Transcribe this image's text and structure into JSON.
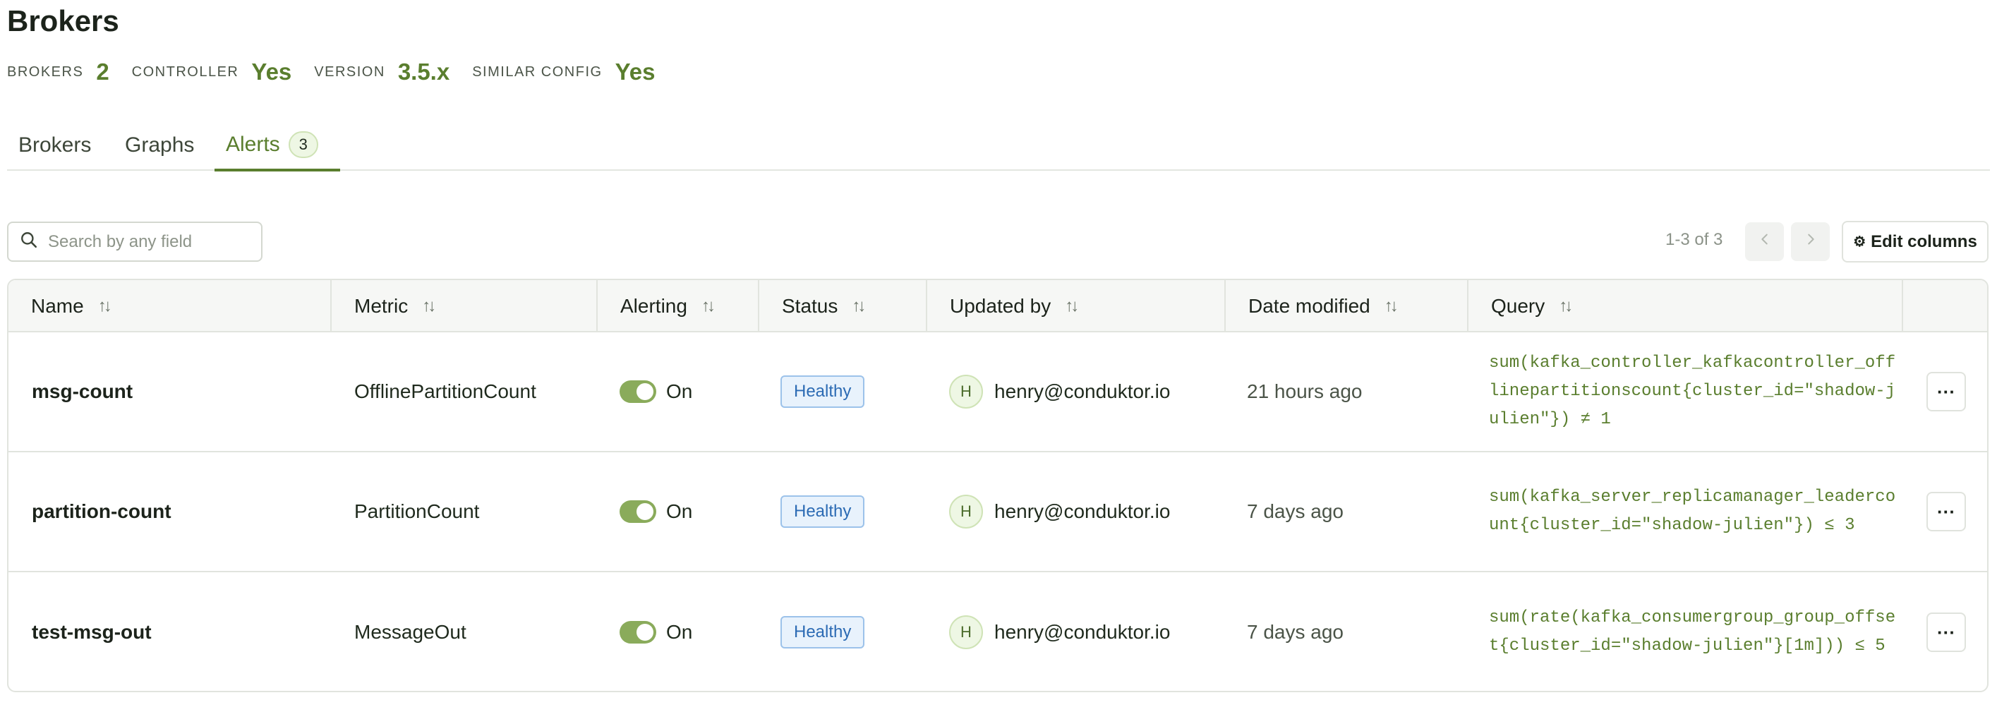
{
  "page": {
    "title": "Brokers"
  },
  "stats": [
    {
      "label": "BROKERS",
      "value": "2"
    },
    {
      "label": "CONTROLLER",
      "value": "Yes"
    },
    {
      "label": "VERSION",
      "value": "3.5.x"
    },
    {
      "label": "SIMILAR CONFIG",
      "value": "Yes"
    }
  ],
  "tabs": {
    "brokers": "Brokers",
    "graphs": "Graphs",
    "alerts": "Alerts",
    "alerts_count": "3",
    "active": "alerts"
  },
  "search": {
    "placeholder": "Search by any field",
    "value": ""
  },
  "pagination": {
    "text": "1-3 of 3"
  },
  "toolbar": {
    "edit_columns_label": "Edit columns"
  },
  "table": {
    "columns": [
      "Name",
      "Metric",
      "Alerting",
      "Status",
      "Updated by",
      "Date modified",
      "Query"
    ],
    "rows": [
      {
        "name": "msg-count",
        "metric": "OfflinePartitionCount",
        "alerting": "On",
        "status": "Healthy",
        "updated_by_initial": "H",
        "updated_by": "henry@conduktor.io",
        "date_modified": "21 hours ago",
        "query": "sum(kafka_controller_kafkacontroller_offlinepartitionscount{cluster_id=\"shadow-julien\"}) ≠ 1"
      },
      {
        "name": "partition-count",
        "metric": "PartitionCount",
        "alerting": "On",
        "status": "Healthy",
        "updated_by_initial": "H",
        "updated_by": "henry@conduktor.io",
        "date_modified": "7 days ago",
        "query": "sum(kafka_server_replicamanager_leadercount{cluster_id=\"shadow-julien\"}) ≤ 3"
      },
      {
        "name": "test-msg-out",
        "metric": "MessageOut",
        "alerting": "On",
        "status": "Healthy",
        "updated_by_initial": "H",
        "updated_by": "henry@conduktor.io",
        "date_modified": "7 days ago",
        "query": "sum(rate(kafka_consumergroup_group_offset{cluster_id=\"shadow-julien\"}[1m])) ≤ 5"
      }
    ]
  },
  "icons": {
    "search": "search-icon",
    "sort": "sort-icon",
    "prev": "chevron-left-icon",
    "next": "chevron-right-icon",
    "gear": "gear-icon",
    "more": "more-horizontal-icon"
  },
  "colors": {
    "accent": "#5a7e2e",
    "toggle_on": "#8aab5b",
    "badge_healthy_bg": "#e8f2fc",
    "badge_healthy_text": "#2c6bb4"
  }
}
